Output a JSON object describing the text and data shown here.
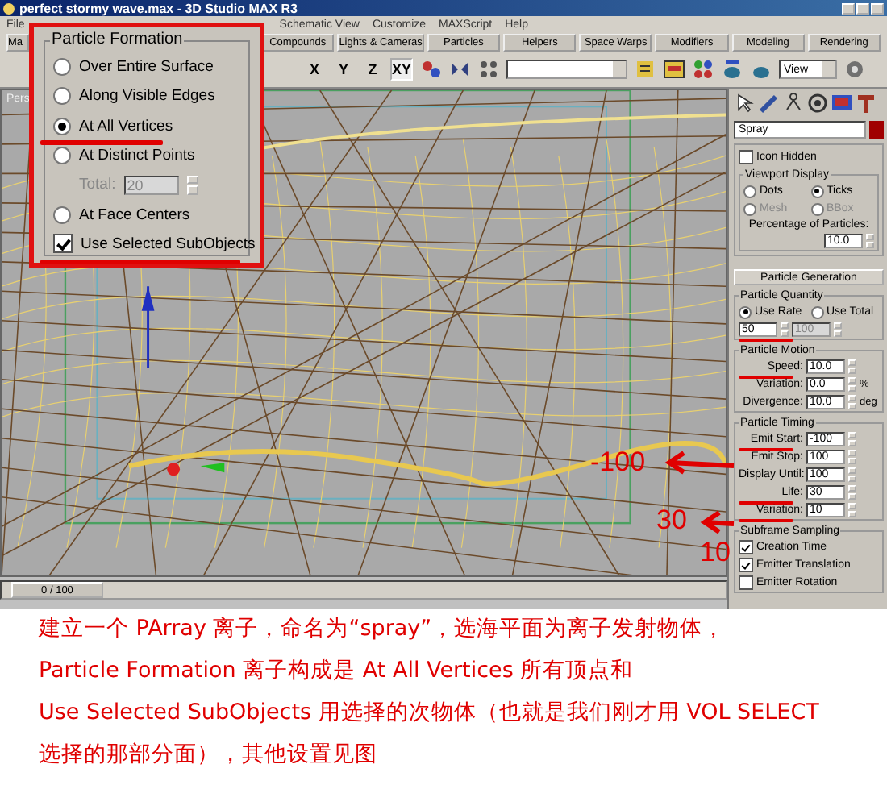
{
  "window": {
    "title": "perfect stormy wave.max - 3D Studio MAX R3"
  },
  "menu_bar": [
    "File",
    "Schematic View",
    "Customize",
    "MAXScript",
    "Help"
  ],
  "tab_bar": [
    "Ma",
    "Compounds",
    "Lights & Cameras",
    "Particles",
    "Helpers",
    "Space Warps",
    "Modifiers",
    "Modeling",
    "Rendering"
  ],
  "toolbar": {
    "axis_buttons": [
      {
        "label": "X",
        "selected": false
      },
      {
        "label": "Y",
        "selected": false
      },
      {
        "label": "Z",
        "selected": false
      },
      {
        "label": "XY",
        "selected": true
      }
    ],
    "view_dropdown": "View"
  },
  "viewport": {
    "label": "Pers"
  },
  "time_slider": {
    "label": "0 / 100",
    "level": 0
  },
  "particle_formation": {
    "title": "Particle Formation",
    "options": [
      {
        "label": "Over Entire Surface",
        "selected": false
      },
      {
        "label": "Along Visible Edges",
        "selected": false
      },
      {
        "label": "At All Vertices",
        "selected": true
      },
      {
        "label": "At Distinct Points",
        "selected": false
      },
      {
        "label": "At Face Centers",
        "selected": false
      }
    ],
    "total": {
      "label": "Total:",
      "value": "20",
      "disabled": true
    },
    "use_selected_subobjects": {
      "label": "Use Selected SubObjects",
      "checked": true
    }
  },
  "command_panel": {
    "object_name": "Spray",
    "icon_hidden": {
      "label": "Icon Hidden",
      "checked": false
    },
    "viewport_display": {
      "title": "Viewport Display",
      "options": [
        {
          "label": "Dots",
          "selected": false,
          "disabled": false
        },
        {
          "label": "Ticks",
          "selected": true,
          "disabled": false
        },
        {
          "label": "Mesh",
          "selected": false,
          "disabled": true
        },
        {
          "label": "BBox",
          "selected": false,
          "disabled": true
        }
      ],
      "percentage_label": "Percentage of Particles:",
      "percentage_value": "10.0"
    },
    "rollout_button": "Particle Generation",
    "particle_quantity": {
      "title": "Particle Quantity",
      "options": [
        {
          "label": "Use Rate",
          "selected": true
        },
        {
          "label": "Use Total",
          "selected": false
        }
      ],
      "rate": "50",
      "total": "100"
    },
    "particle_motion": {
      "title": "Particle Motion",
      "rows": [
        {
          "label": "Speed:",
          "value": "10.0"
        },
        {
          "label": "Variation:",
          "value": "0.0",
          "unit": "%"
        },
        {
          "label": "Divergence:",
          "value": "10.0",
          "unit": "deg"
        }
      ]
    },
    "particle_timing": {
      "title": "Particle Timing",
      "rows": [
        {
          "label": "Emit Start:",
          "value": "-100"
        },
        {
          "label": "Emit Stop:",
          "value": "100"
        },
        {
          "label": "Display Until:",
          "value": "100"
        },
        {
          "label": "Life:",
          "value": "30"
        },
        {
          "label": "Variation:",
          "value": "10"
        }
      ]
    },
    "subframe_sampling": {
      "title": "Subframe Sampling",
      "items": [
        {
          "label": "Creation Time",
          "checked": true
        },
        {
          "label": "Emitter Translation",
          "checked": true
        },
        {
          "label": "Emitter Rotation",
          "checked": false
        }
      ]
    }
  },
  "annotations": [
    "-100",
    "30",
    "10"
  ],
  "caption": [
    "建立一个 PArray 离子，命名为“spray”，选海平面为离子发射物体，",
    "Particle Formation 离子构成是 At All Vertices 所有顶点和",
    "Use Selected SubObjects 用选择的次物体（也就是我们刚才用 VOL SELECT",
    "选择的那部分面），其他设置见图"
  ]
}
